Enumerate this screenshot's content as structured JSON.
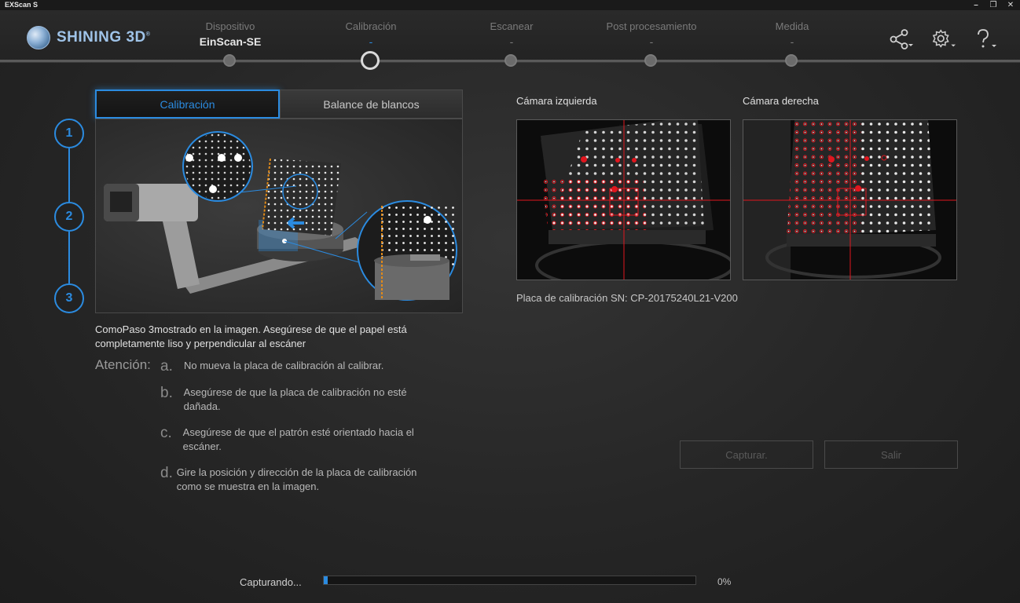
{
  "window": {
    "title": "EXScan S"
  },
  "brand": {
    "name": "SHINING 3D",
    "mark": "®"
  },
  "steps": [
    {
      "label": "Dispositivo",
      "value": "EinScan-SE"
    },
    {
      "label": "Calibración",
      "value": "-"
    },
    {
      "label": "Escanear",
      "value": "-"
    },
    {
      "label": "Post procesamiento",
      "value": "-"
    },
    {
      "label": "Medida",
      "value": "-"
    }
  ],
  "header_icons": [
    "share-icon",
    "gear-icon",
    "help-icon"
  ],
  "tabs": {
    "calibration": "Calibración",
    "white_balance": "Balance de blancos"
  },
  "step_numbers": [
    "1",
    "2",
    "3"
  ],
  "instructions": {
    "description": "ComoPaso 3mostrado en la imagen. Asegúrese de que el papel está completamente liso y perpendicular al escáner",
    "attention_title": "Atención:",
    "notes": [
      {
        "letter": "a.",
        "text": "No mueva la placa de calibración al calibrar."
      },
      {
        "letter": "b.",
        "text": "Asegúrese de que la placa de calibración no esté dañada."
      },
      {
        "letter": "c.",
        "text": "Asegúrese de que el patrón esté orientado hacia el escáner."
      },
      {
        "letter": "d.",
        "text": "Gire la posición y dirección de la placa de calibración como se muestra en la imagen."
      }
    ]
  },
  "cameras": {
    "left_label": "Cámara izquierda",
    "right_label": "Cámara derecha"
  },
  "serial": "Placa de calibración SN: CP-20175240L21-V200",
  "buttons": {
    "capture": "Capturar.",
    "exit": "Salir"
  },
  "progress": {
    "label": "Capturando...",
    "percent_text": "0%",
    "value": 0.01
  },
  "colors": {
    "accent": "#2b8be0",
    "crosshair": "#e0161e"
  }
}
